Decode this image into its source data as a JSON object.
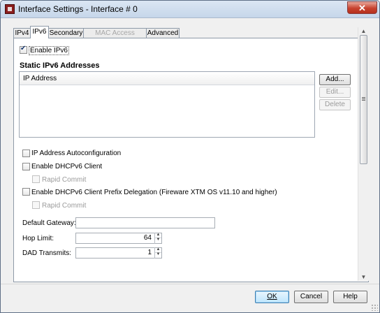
{
  "window": {
    "title": "Interface Settings - Interface # 0"
  },
  "tabs": [
    {
      "label": "IPv4",
      "state": "normal"
    },
    {
      "label": "IPv6",
      "state": "active"
    },
    {
      "label": "Secondary",
      "state": "normal"
    },
    {
      "label": "MAC Access Control",
      "state": "disabled"
    },
    {
      "label": "Advanced",
      "state": "normal"
    }
  ],
  "enable_ipv6": {
    "label": "Enable IPv6",
    "checked": true
  },
  "static_section": {
    "title": "Static IPv6 Addresses",
    "column_header": "IP Address",
    "rows": []
  },
  "list_buttons": {
    "add": "Add...",
    "edit": "Edit...",
    "delete": "Delete"
  },
  "options": {
    "autoconf": {
      "label": "IP Address Autoconfiguration",
      "checked": false
    },
    "dhcpv6_client": {
      "label": "Enable DHCPv6 Client",
      "checked": false
    },
    "rapid_commit_1": {
      "label": "Rapid Commit",
      "checked": false,
      "enabled": false
    },
    "prefix_delegation": {
      "label": "Enable DHCPv6 Client Prefix Delegation (Fireware XTM OS v11.10 and higher)",
      "checked": false
    },
    "rapid_commit_2": {
      "label": "Rapid Commit",
      "checked": false,
      "enabled": false
    }
  },
  "fields": {
    "default_gateway": {
      "label": "Default Gateway:",
      "value": ""
    },
    "hop_limit": {
      "label": "Hop Limit:",
      "value": "64"
    },
    "dad_transmits": {
      "label": "DAD Transmits:",
      "value": "1"
    }
  },
  "footer": {
    "ok": "OK",
    "cancel": "Cancel",
    "help": "Help"
  }
}
